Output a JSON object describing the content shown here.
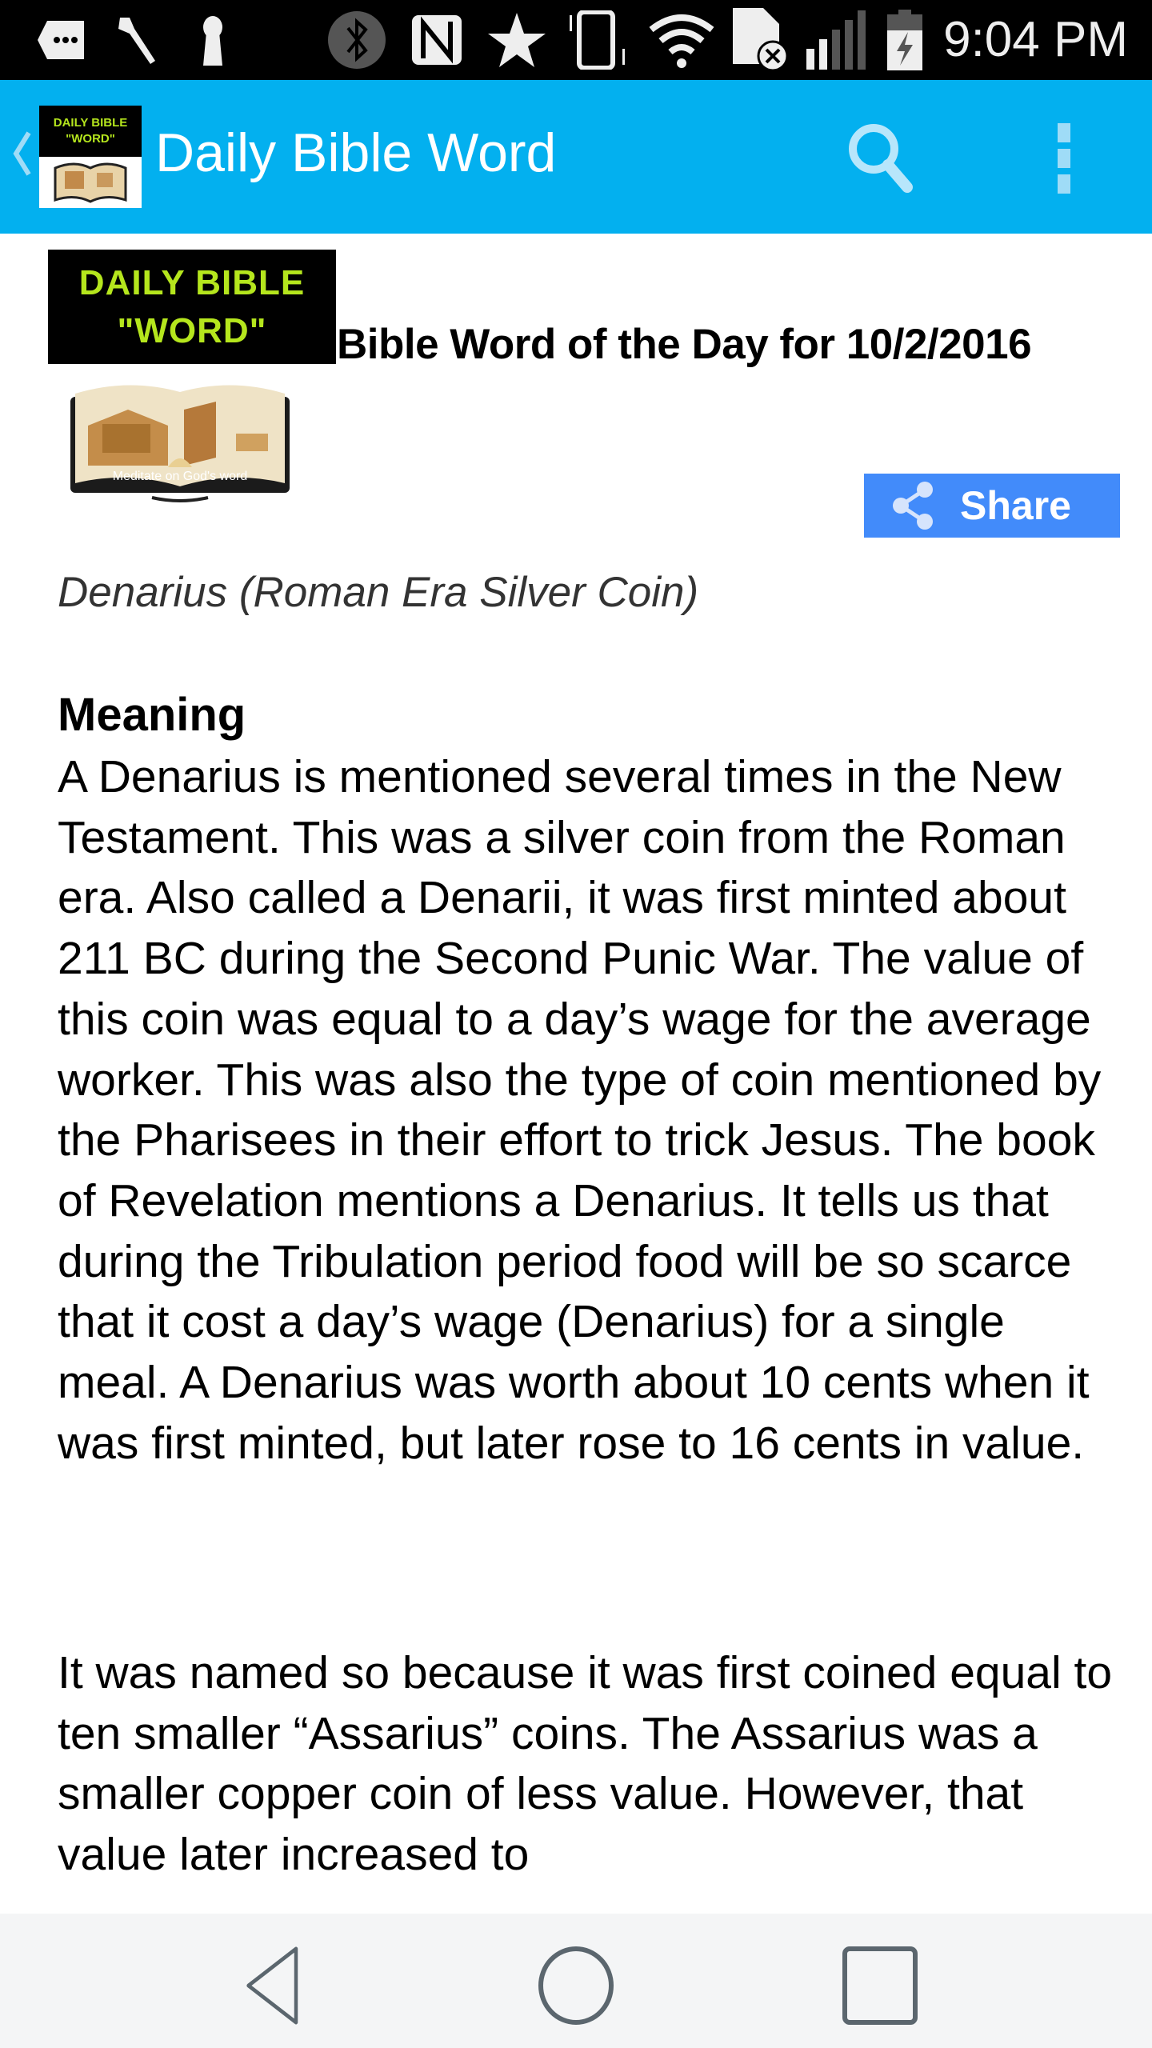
{
  "status_bar": {
    "time": "9:04 PM",
    "left_icons": [
      "messaging-icon",
      "wrench-icon",
      "keyhole-icon"
    ],
    "right_icons": [
      "bluetooth-icon",
      "nfc-icon",
      "star-icon",
      "vibrate-icon",
      "wifi-icon",
      "no-sim-icon",
      "signal-icon",
      "battery-charging-icon"
    ]
  },
  "action_bar": {
    "title": "Daily Bible Word",
    "logo_line1": "DAILY BIBLE",
    "logo_line2": "\"WORD\"",
    "accent_color": "#03b0ef"
  },
  "content": {
    "banner_line1": "DAILY BIBLE",
    "banner_line2": "\"WORD\"",
    "heading": "Bible Word of the Day for 10/2/2016",
    "image_caption": "Meditate on God's word",
    "share_label": "Share",
    "share_color": "#428bfa",
    "word_title": "Denarius (Roman Era Silver Coin)",
    "section_heading": "Meaning",
    "paragraphs": [
      "A Denarius is mentioned several times in the New Testament. This was a silver coin from the Roman era. Also called a Denarii, it was first minted about 211 BC during the Second Punic War. The value of this coin was equal to a day’s wage for the average worker. This was also the type of coin mentioned by the Pharisees in their effort to trick Jesus. The book of Revelation mentions a Denarius. It tells us that during the Tribulation period food will be so scarce that it cost a day’s wage (Denarius) for a single meal. A Denarius was worth about 10 cents when it was first minted, but later rose to 16 cents in value.",
      "It was named so because it was first coined equal to ten smaller “Assarius” coins. The Assarius was a smaller copper coin of less value. However, that value later increased to"
    ]
  },
  "nav_bar": {
    "buttons": [
      "back",
      "home",
      "recents"
    ]
  }
}
